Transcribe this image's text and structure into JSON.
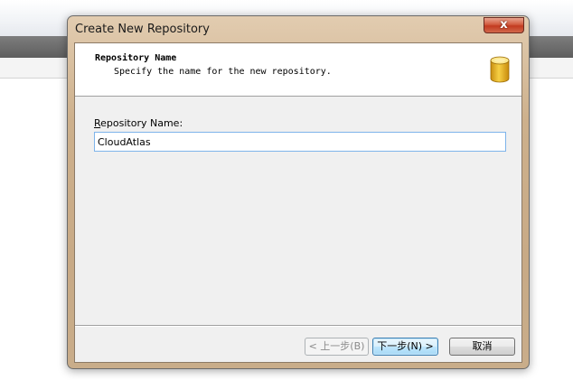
{
  "dialog": {
    "title": "Create New Repository",
    "close_label": "x",
    "header": {
      "title": "Repository Name",
      "subtitle": "Specify the name for the new repository.",
      "icon": "database-icon"
    },
    "form": {
      "name_label_accel": "R",
      "name_label_rest": "epository Name:",
      "name_value": "CloudAtlas"
    },
    "buttons": {
      "back": "< 上一步(B)",
      "next": "下一步(N) >",
      "cancel": "取消"
    }
  },
  "colors": {
    "title_bar": "#cdb08c",
    "close_button": "#c23a20",
    "input_border": "#7eb4ea",
    "default_button_border": "#3c7fb1",
    "icon_fill": "#f2c230"
  }
}
